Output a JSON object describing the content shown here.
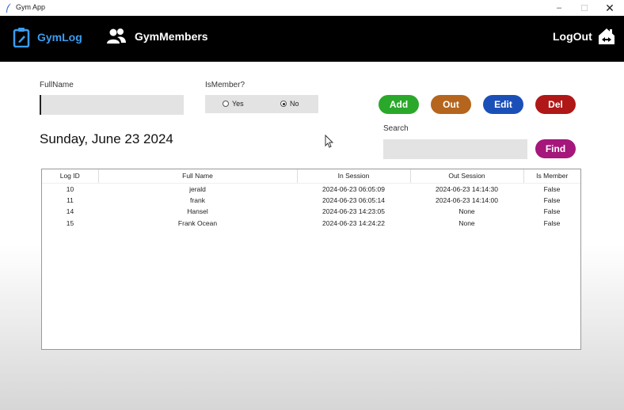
{
  "window": {
    "title": "Gym App",
    "controls": {
      "minimize": "–",
      "maximize": "☐",
      "close": "✕"
    }
  },
  "nav": {
    "gymlog": {
      "label": "GymLog",
      "icon": "clipboard-icon",
      "active": true,
      "color": "#3a9df0"
    },
    "gymmembers": {
      "label": "GymMembers",
      "icon": "people-icon"
    },
    "logout": {
      "label": "LogOut",
      "icon": "house-exit-icon"
    }
  },
  "form": {
    "fullname_label": "FullName",
    "fullname_value": "",
    "ismember_label": "IsMember?",
    "ismember_options": [
      {
        "label": "Yes",
        "selected": false
      },
      {
        "label": "No",
        "selected": true
      }
    ],
    "search_label": "Search",
    "search_value": ""
  },
  "buttons": {
    "add": {
      "label": "Add",
      "color": "#2aa82a"
    },
    "out": {
      "label": "Out",
      "color": "#b5651d"
    },
    "edit": {
      "label": "Edit",
      "color": "#1b4fb8"
    },
    "del": {
      "label": "Del",
      "color": "#b01717"
    },
    "find": {
      "label": "Find",
      "color": "#a5177a"
    }
  },
  "date_text": "Sunday, June 23 2024",
  "table": {
    "columns": [
      "Log ID",
      "Full Name",
      "In Session",
      "Out Session",
      "Is Member"
    ],
    "rows": [
      [
        "10",
        "jerald",
        "2024-06-23 06:05:09",
        "2024-06-23 14:14:30",
        "False"
      ],
      [
        "11",
        "frank",
        "2024-06-23 06:05:14",
        "2024-06-23 14:14:00",
        "False"
      ],
      [
        "14",
        "Hansel",
        "2024-06-23 14:23:05",
        "None",
        "False"
      ],
      [
        "15",
        "Frank Ocean",
        "2024-06-23 14:24:22",
        "None",
        "False"
      ]
    ]
  }
}
